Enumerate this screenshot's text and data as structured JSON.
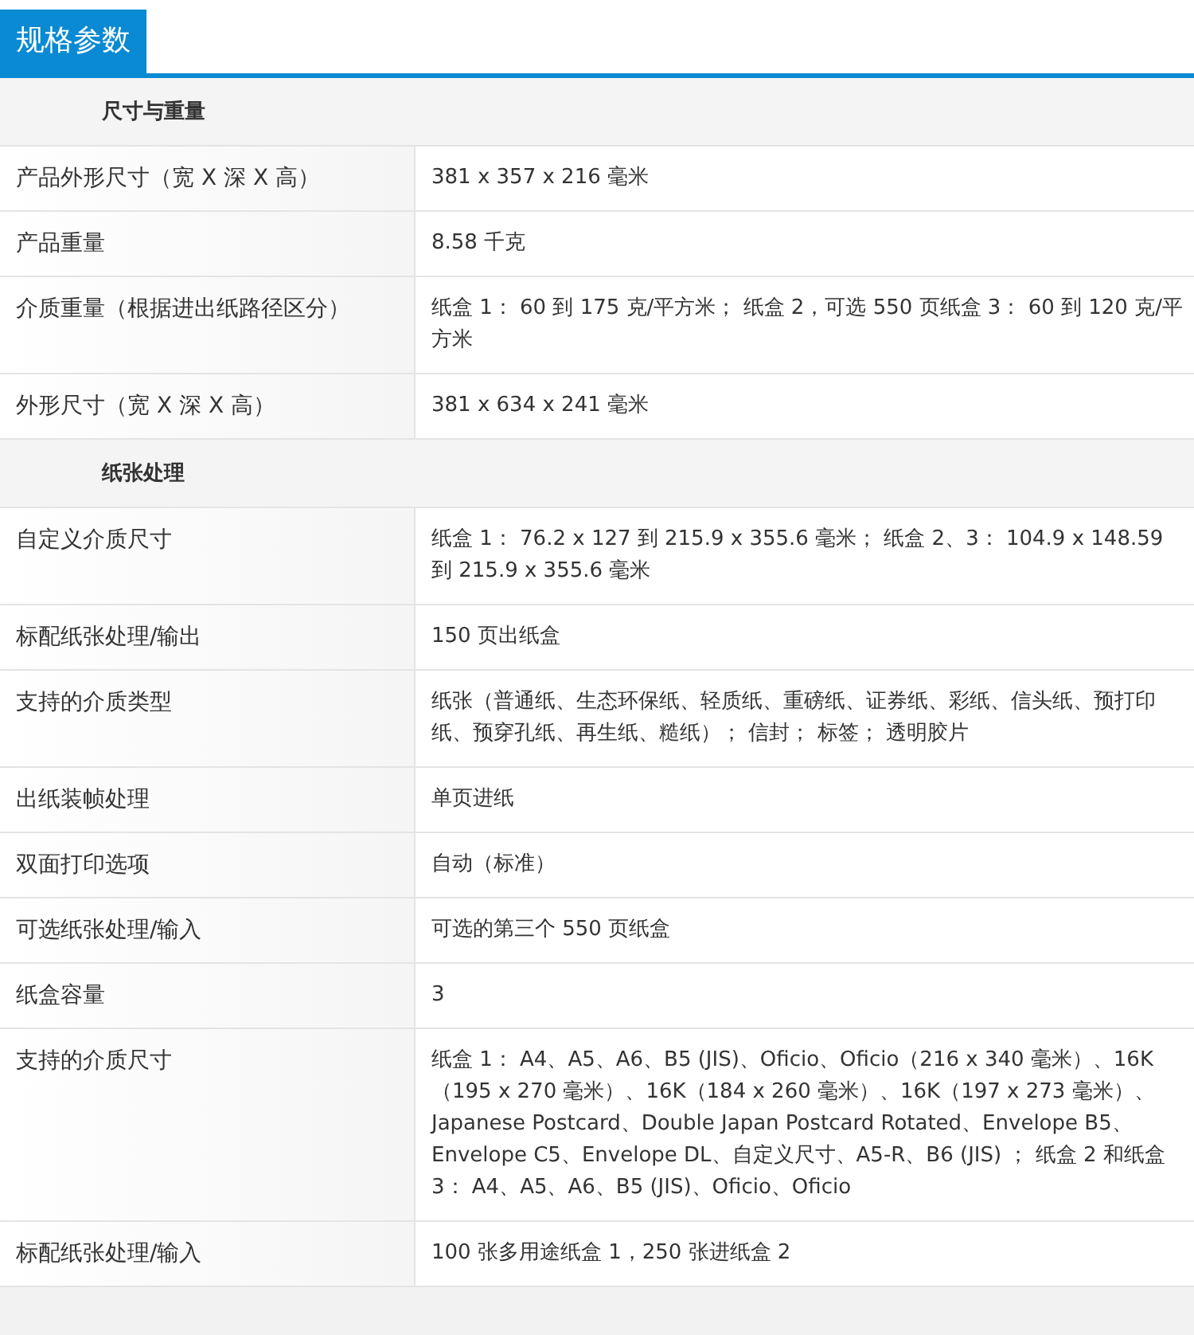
{
  "title": "规格参数",
  "sections": [
    {
      "heading": "尺寸与重量",
      "rows": [
        {
          "label": "产品外形尺寸（宽 X 深 X 高）",
          "value": "381 x 357 x 216 毫米"
        },
        {
          "label": "产品重量",
          "value": "8.58 千克"
        },
        {
          "label": "介质重量（根据进出纸路径区分）",
          "value": "纸盒 1： 60 到 175 克/平方米； 纸盒 2，可选 550 页纸盒 3： 60 到 120 克/平方米"
        },
        {
          "label": "外形尺寸（宽 X 深 X 高）",
          "value": "381 x 634 x 241 毫米"
        }
      ]
    },
    {
      "heading": "纸张处理",
      "rows": [
        {
          "label": "自定义介质尺寸",
          "value": "纸盒 1： 76.2 x 127 到 215.9 x 355.6 毫米； 纸盒 2、3： 104.9 x 148.59 到 215.9 x 355.6 毫米"
        },
        {
          "label": "标配纸张处理/输出",
          "value": "150 页出纸盒"
        },
        {
          "label": "支持的介质类型",
          "value": "纸张（普通纸、生态环保纸、轻质纸、重磅纸、证券纸、彩纸、信头纸、预打印纸、预穿孔纸、再生纸、糙纸）； 信封； 标签； 透明胶片"
        },
        {
          "label": "出纸装帧处理",
          "value": "单页进纸"
        },
        {
          "label": "双面打印选项",
          "value": "自动（标准）"
        },
        {
          "label": "可选纸张处理/输入",
          "value": "可选的第三个 550 页纸盒"
        },
        {
          "label": "纸盒容量",
          "value": "3"
        },
        {
          "label": "支持的介质尺寸",
          "value": "纸盒 1： A4、A5、A6、B5 (JIS)、Oficio、Oficio（216 x 340 毫米）、16K（195 x 270 毫米）、16K（184 x 260 毫米）、16K（197 x 273 毫米）、Japanese Postcard、Double Japan Postcard Rotated、Envelope B5、Envelope C5、Envelope DL、自定义尺寸、A5-R、B6 (JIS) ； 纸盒 2 和纸盒 3： A4、A5、A6、B5 (JIS)、Oficio、Oficio"
        },
        {
          "label": "标配纸张处理/输入",
          "value": "100 张多用途纸盒 1，250 张进纸盒 2"
        }
      ]
    }
  ]
}
